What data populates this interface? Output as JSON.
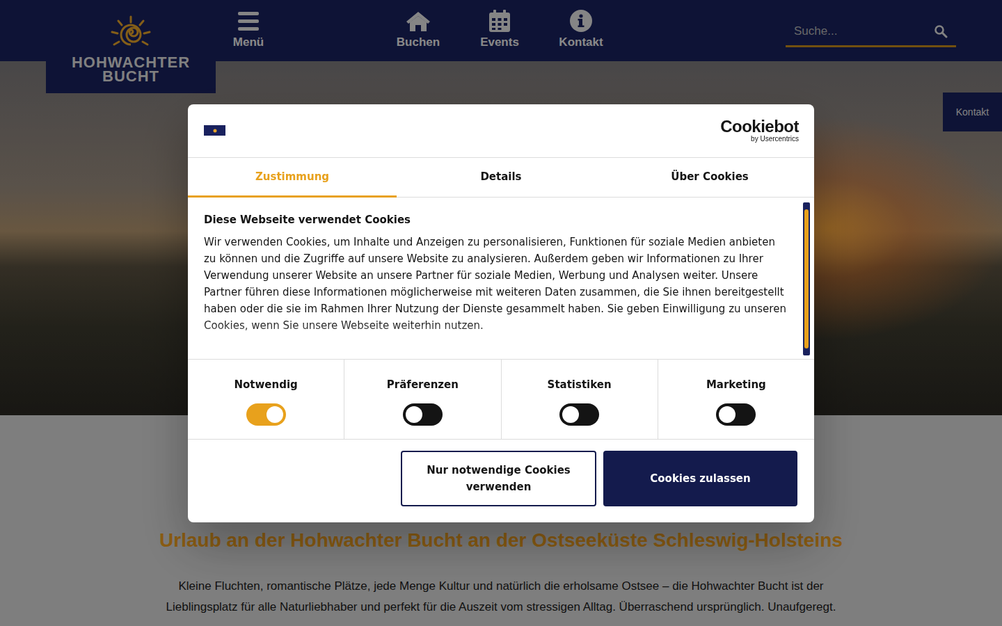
{
  "header": {
    "logo": {
      "line1": "HOHWACHTER",
      "line2": "BUCHT"
    },
    "menu": "Menü",
    "nav": [
      {
        "label": "Buchen"
      },
      {
        "label": "Events"
      },
      {
        "label": "Kontakt"
      }
    ],
    "search": {
      "placeholder": "Suche..."
    }
  },
  "side_tab": "Kontakt",
  "page": {
    "heading": "Urlaub an der Hohwachter Bucht an der Ostseeküste Schleswig-Holsteins",
    "lines": [
      "Kleine Fluchten, romantische Plätze, jede Menge Kultur und natürlich die erholsame Ostsee – die Hohwachter Bucht ist der",
      "Lieblingsplatz für alle Naturliebhaber und perfekt für die Auszeit vom stressigen Alltag. Überraschend ursprünglich. Unaufgeregt."
    ]
  },
  "dialog": {
    "brand": {
      "name": "Cookiebot",
      "sub": "by Usercentrics"
    },
    "tabs": [
      {
        "label": "Zustimmung",
        "selected": true
      },
      {
        "label": "Details",
        "selected": false
      },
      {
        "label": "Über Cookies",
        "selected": false
      }
    ],
    "title": "Diese Webseite verwendet Cookies",
    "text": "Wir verwenden Cookies, um Inhalte und Anzeigen zu personalisieren, Funktionen für soziale Medien anbieten zu können und die Zugriffe auf unsere Website zu analysieren. Außerdem geben wir Informationen zu Ihrer Verwendung unserer Website an unsere Partner für soziale Medien, Werbung und Analysen weiter. Unsere Partner führen diese Informationen möglicherweise mit weiteren Daten zusammen, die Sie ihnen bereitgestellt haben oder die sie im Rahmen Ihrer Nutzung der Dienste gesammelt haben. Sie geben Einwilligung zu unseren Cookies, wenn Sie unsere Webseite weiterhin nutzen.",
    "toggles": [
      {
        "label": "Notwendig",
        "on": true
      },
      {
        "label": "Präferenzen",
        "on": false
      },
      {
        "label": "Statistiken",
        "on": false
      },
      {
        "label": "Marketing",
        "on": false
      }
    ],
    "buttons": [
      "Nur notwendige Cookies verwenden",
      "Cookies zulassen"
    ]
  }
}
